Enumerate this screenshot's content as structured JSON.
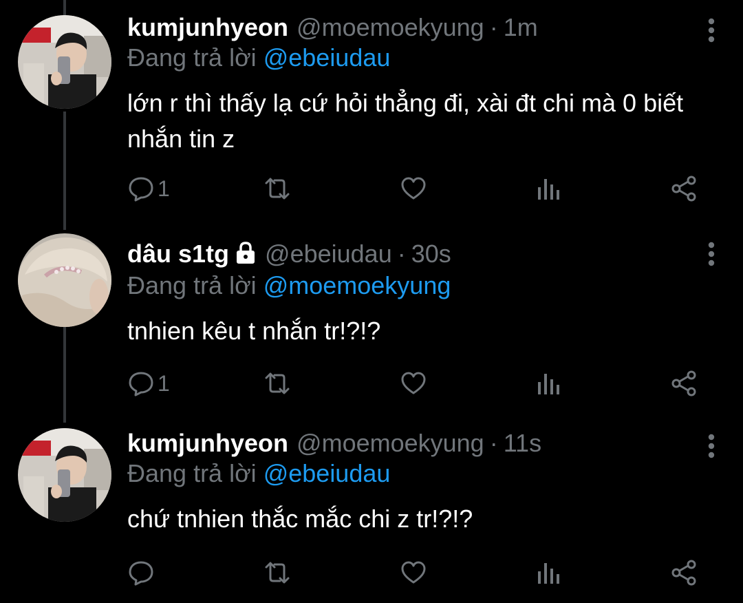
{
  "theme": {
    "background": "#000000",
    "text_primary": "#ffffff",
    "text_secondary": "#71767b",
    "accent": "#1d9bf0",
    "thread_line": "#333639"
  },
  "tweets": [
    {
      "display_name": "kumjunhyeon",
      "handle": "@moemoekyung",
      "separator": "·",
      "time": "1m",
      "replying_prefix": "Đang trả lời",
      "replying_to": "@ebeiudau",
      "text": "lớn r thì thấy lạ cứ hỏi thẳng đi, xài đt chi mà 0 biết nhắn tin z",
      "reply_count": "1",
      "avatar": "profile-photo-mirror-selfie",
      "locked": false
    },
    {
      "display_name": "dâu s1tg",
      "handle": "@ebeiudau",
      "separator": "·",
      "time": "30s",
      "replying_prefix": "Đang trả lời",
      "replying_to": "@moemoekyung",
      "text": "tnhien kêu t nhắn tr!?!?",
      "reply_count": "1",
      "avatar": "profile-photo-hair-tiara",
      "locked": true
    },
    {
      "display_name": "kumjunhyeon",
      "handle": "@moemoekyung",
      "separator": "·",
      "time": "11s",
      "replying_prefix": "Đang trả lời",
      "replying_to": "@ebeiudau",
      "text": "chứ tnhien thắc mắc chi z tr!?!?",
      "reply_count": "",
      "avatar": "profile-photo-mirror-selfie",
      "locked": false
    }
  ],
  "icons": {
    "reply": "reply-bubble-icon",
    "retweet": "retweet-icon",
    "like": "heart-icon",
    "views": "analytics-bars-icon",
    "share": "share-icon",
    "more": "more-vertical-icon",
    "lock": "lock-icon"
  }
}
